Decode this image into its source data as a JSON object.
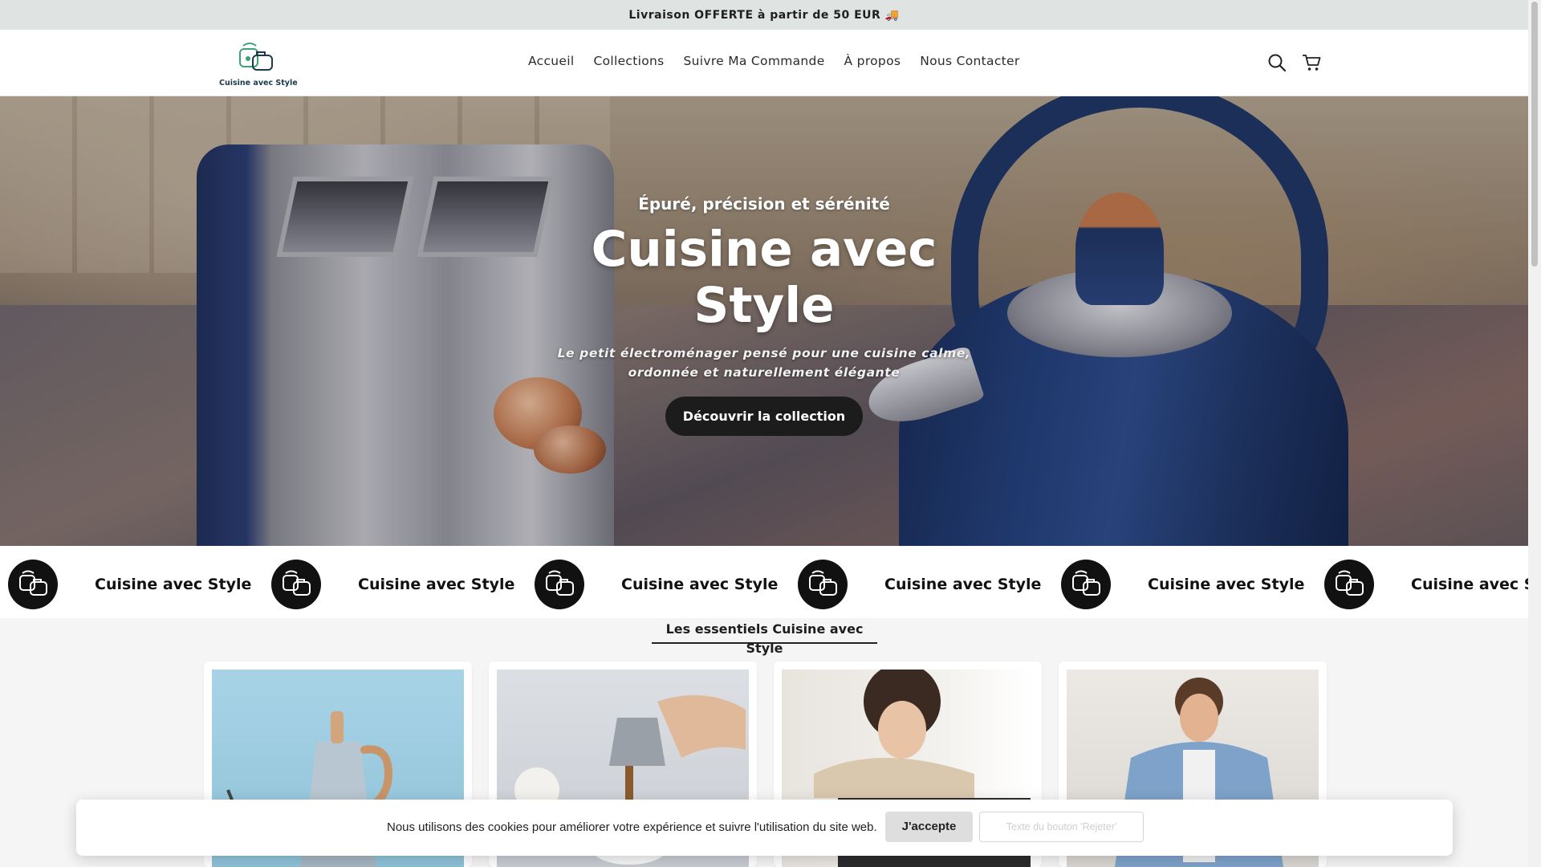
{
  "announcement": {
    "text": "Livraison OFFERTE à partir de 50 EUR 🚚"
  },
  "brand": {
    "name": "Cuisine avec Style",
    "logo_icon": "kitchen-appliances-logo-icon",
    "accent": "#3aa37a"
  },
  "nav": {
    "items": [
      {
        "label": "Accueil"
      },
      {
        "label": "Collections"
      },
      {
        "label": "Suivre Ma Commande"
      },
      {
        "label": "À propos"
      },
      {
        "label": "Nous Contacter"
      }
    ]
  },
  "header_icons": {
    "search": "search-icon",
    "cart": "cart-icon"
  },
  "hero": {
    "subtitle": "Épuré, précision et sérénité",
    "title": "Cuisine avec Style",
    "description": "Le petit électroménager pensé pour une cuisine calme, ordonnée et naturellement élégante",
    "cta": "Découvrir la collection"
  },
  "marquee": {
    "text": "Cuisine avec Style",
    "icon": "appliances-circle-icon",
    "repeat": 6
  },
  "section": {
    "title": "Les essentiels Cuisine avec Style"
  },
  "products": [
    {
      "image": "moka-pot-photo"
    },
    {
      "image": "pouring-coffee-photo"
    },
    {
      "image": "woman-oven-photo"
    },
    {
      "image": "man-cooking-photo"
    }
  ],
  "cookie_banner": {
    "text": "Nous utilisons des cookies pour améliorer votre expérience et suivre l'utilisation du site web.",
    "accept": "J'accepte",
    "reject": "Texte du bouton 'Rejeter'"
  },
  "colors": {
    "announcement_bg": "#dfe3e1",
    "button_dark": "#1c1c1c",
    "kettle_blue": "#1e3566"
  }
}
